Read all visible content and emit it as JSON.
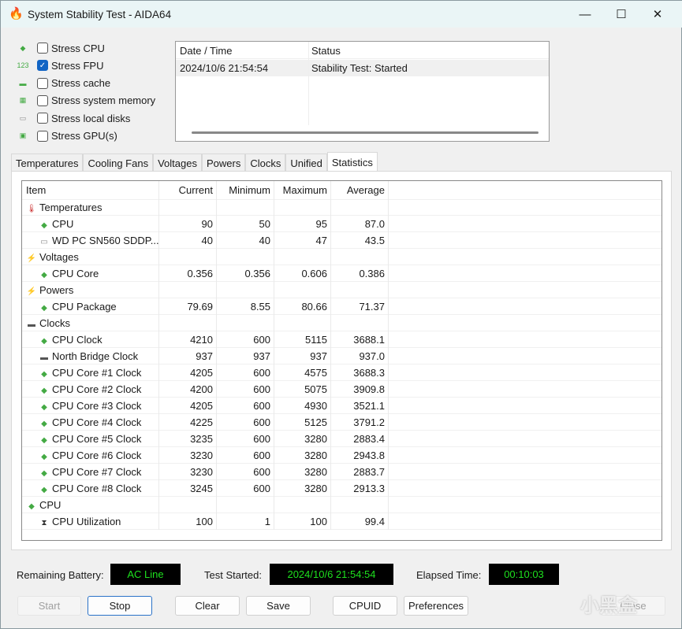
{
  "window": {
    "title": "System Stability Test - AIDA64",
    "minimize": "—",
    "maximize": "☐",
    "close": "✕"
  },
  "stress": [
    {
      "label": "Stress CPU",
      "checked": false,
      "icon": "cpu-icon"
    },
    {
      "label": "Stress FPU",
      "checked": true,
      "icon": "fpu-icon"
    },
    {
      "label": "Stress cache",
      "checked": false,
      "icon": "cache-icon"
    },
    {
      "label": "Stress system memory",
      "checked": false,
      "icon": "memory-icon"
    },
    {
      "label": "Stress local disks",
      "checked": false,
      "icon": "disk-icon"
    },
    {
      "label": "Stress GPU(s)",
      "checked": false,
      "icon": "gpu-icon"
    }
  ],
  "log": {
    "headers": [
      "Date / Time",
      "Status"
    ],
    "rows": [
      [
        "2024/10/6 21:54:54",
        "Stability Test: Started"
      ]
    ]
  },
  "tabs": [
    "Temperatures",
    "Cooling Fans",
    "Voltages",
    "Powers",
    "Clocks",
    "Unified",
    "Statistics"
  ],
  "active_tab": "Statistics",
  "stats": {
    "headers": [
      "Item",
      "Current",
      "Minimum",
      "Maximum",
      "Average"
    ],
    "rows": [
      {
        "group": true,
        "item": "Temperatures",
        "icon": "thermometer-icon"
      },
      {
        "item": "CPU",
        "v": [
          "90",
          "50",
          "95",
          "87.0"
        ],
        "icon": "cpu-icon"
      },
      {
        "item": "WD PC SN560 SDDP...",
        "v": [
          "40",
          "40",
          "47",
          "43.5"
        ],
        "icon": "disk-icon"
      },
      {
        "group": true,
        "item": "Voltages",
        "icon": "voltage-icon"
      },
      {
        "item": "CPU Core",
        "v": [
          "0.356",
          "0.356",
          "0.606",
          "0.386"
        ],
        "icon": "cpu-icon"
      },
      {
        "group": true,
        "item": "Powers",
        "icon": "power-icon"
      },
      {
        "item": "CPU Package",
        "v": [
          "79.69",
          "8.55",
          "80.66",
          "71.37"
        ],
        "icon": "cpu-icon"
      },
      {
        "group": true,
        "item": "Clocks",
        "icon": "clock-chip-icon"
      },
      {
        "item": "CPU Clock",
        "v": [
          "4210",
          "600",
          "5115",
          "3688.1"
        ],
        "icon": "cpu-icon"
      },
      {
        "item": "North Bridge Clock",
        "v": [
          "937",
          "937",
          "937",
          "937.0"
        ],
        "icon": "chip-icon"
      },
      {
        "item": "CPU Core #1 Clock",
        "v": [
          "4205",
          "600",
          "4575",
          "3688.3"
        ],
        "icon": "cpu-icon"
      },
      {
        "item": "CPU Core #2 Clock",
        "v": [
          "4200",
          "600",
          "5075",
          "3909.8"
        ],
        "icon": "cpu-icon"
      },
      {
        "item": "CPU Core #3 Clock",
        "v": [
          "4205",
          "600",
          "4930",
          "3521.1"
        ],
        "icon": "cpu-icon"
      },
      {
        "item": "CPU Core #4 Clock",
        "v": [
          "4225",
          "600",
          "5125",
          "3791.2"
        ],
        "icon": "cpu-icon"
      },
      {
        "item": "CPU Core #5 Clock",
        "v": [
          "3235",
          "600",
          "3280",
          "2883.4"
        ],
        "icon": "cpu-icon"
      },
      {
        "item": "CPU Core #6 Clock",
        "v": [
          "3230",
          "600",
          "3280",
          "2943.8"
        ],
        "icon": "cpu-icon"
      },
      {
        "item": "CPU Core #7 Clock",
        "v": [
          "3230",
          "600",
          "3280",
          "2883.7"
        ],
        "icon": "cpu-icon"
      },
      {
        "item": "CPU Core #8 Clock",
        "v": [
          "3245",
          "600",
          "3280",
          "2913.3"
        ],
        "icon": "cpu-icon"
      },
      {
        "group": true,
        "item": "CPU",
        "icon": "cpu-icon"
      },
      {
        "item": "CPU Utilization",
        "v": [
          "100",
          "1",
          "100",
          "99.4"
        ],
        "icon": "hourglass-icon"
      }
    ]
  },
  "status": {
    "battery_label": "Remaining Battery:",
    "battery": "AC Line",
    "started_label": "Test Started:",
    "started": "2024/10/6 21:54:54",
    "elapsed_label": "Elapsed Time:",
    "elapsed": "00:10:03",
    "lcd_color": "#1ee01e"
  },
  "buttons": {
    "start": "Start",
    "stop": "Stop",
    "clear": "Clear",
    "save": "Save",
    "cpuid": "CPUID",
    "preferences": "Preferences",
    "close": "Close"
  },
  "watermark": "小黑盒"
}
